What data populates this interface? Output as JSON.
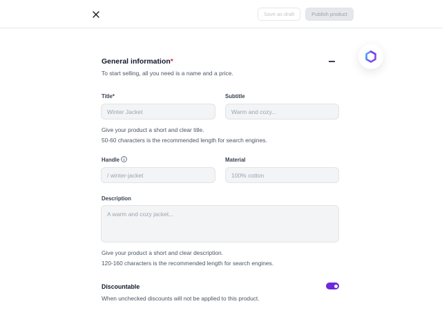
{
  "header": {
    "save_draft_label": "Save as draft",
    "publish_label": "Publish product"
  },
  "general": {
    "title": "General information",
    "required_mark": "*",
    "subtitle": "To start selling, all you need is a name and a price."
  },
  "form": {
    "title": {
      "label": "Title*",
      "placeholder": "Winter Jacket"
    },
    "subtitle": {
      "label": "Subtitle",
      "placeholder": "Warm and cozy..."
    },
    "title_hint_1": "Give your product a short and clear title.",
    "title_hint_2": "50-60 characters is the recommended length for search engines.",
    "handle": {
      "label": "Handle",
      "placeholder": "/ winter-jacket"
    },
    "material": {
      "label": "Material",
      "placeholder": "100% cotton"
    },
    "description": {
      "label": "Description",
      "placeholder": "A warm and cozy jacket..."
    },
    "desc_hint_1": "Give your product a short and clear description.",
    "desc_hint_2": "120-160 characters is the recommended length for search engines."
  },
  "discountable": {
    "label": "Discountable",
    "hint": "When unchecked discounts will not be applied to this product.",
    "enabled": true
  },
  "colors": {
    "accent": "#6d28d9",
    "required": "#e11d48"
  },
  "icons": {
    "close": "close-icon",
    "collapse": "minus-icon",
    "info": "info-icon",
    "logo": "medusa-logo-icon"
  }
}
